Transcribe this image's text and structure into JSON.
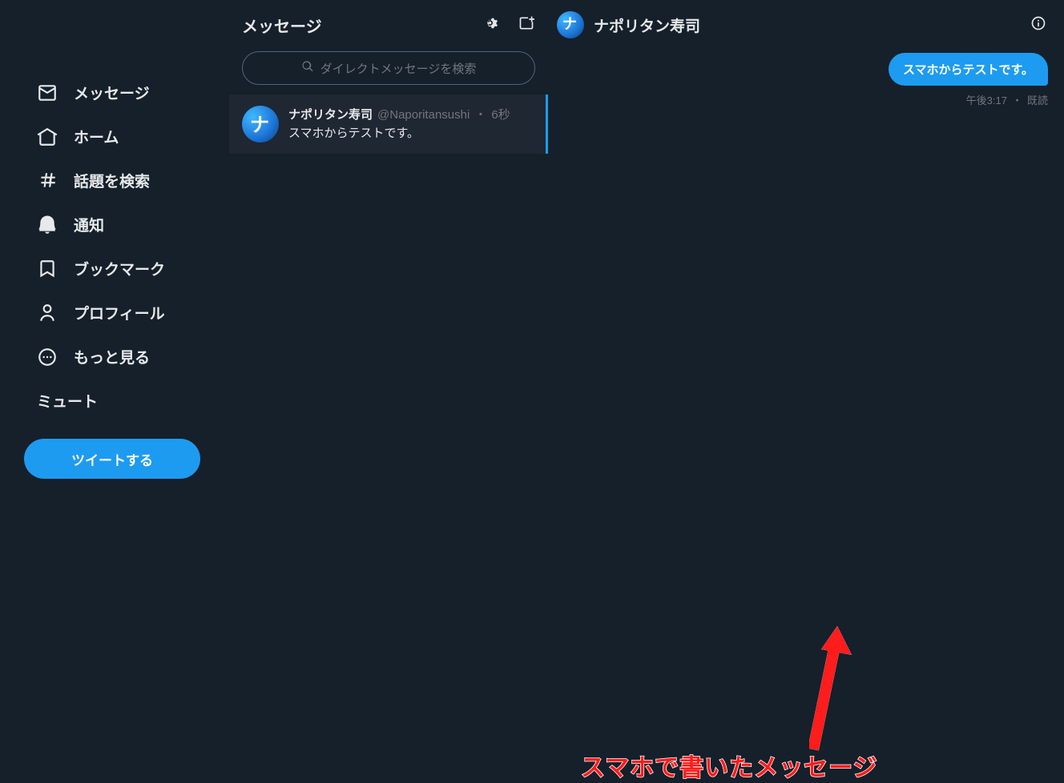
{
  "sidebar": {
    "items": [
      {
        "label": "メッセージ"
      },
      {
        "label": "ホーム"
      },
      {
        "label": "話題を検索"
      },
      {
        "label": "通知"
      },
      {
        "label": "ブックマーク"
      },
      {
        "label": "プロフィール"
      },
      {
        "label": "もっと見る"
      },
      {
        "label": "ミュート"
      }
    ],
    "tweet_label": "ツイートする"
  },
  "dm": {
    "title": "メッセージ",
    "search_placeholder": "ダイレクトメッセージを検索",
    "conversations": [
      {
        "name": "ナポリタン寿司",
        "handle": "@Naporitansushi",
        "time_sep": "・",
        "time": "6秒",
        "preview": "スマホからテストです。"
      }
    ]
  },
  "chat": {
    "title": "ナポリタン寿司",
    "messages": [
      {
        "text": "スマホからテストです。"
      }
    ],
    "meta_time": "午後3:17",
    "meta_sep": "・",
    "meta_status": "既読"
  },
  "annotation": {
    "text": "スマホで書いたメッセージ"
  }
}
